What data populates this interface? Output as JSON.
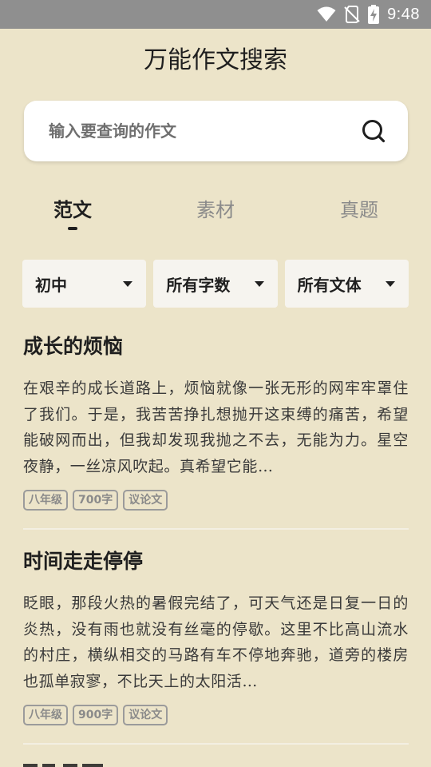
{
  "status_bar": {
    "time": "9:48",
    "icons": [
      "wifi-icon",
      "no-sim-icon",
      "battery-charging-icon"
    ]
  },
  "header": {
    "title": "万能作文搜索"
  },
  "search": {
    "placeholder": "输入要查询的作文",
    "icon": "search-icon"
  },
  "tabs": [
    {
      "label": "范文",
      "active": true
    },
    {
      "label": "素材",
      "active": false
    },
    {
      "label": "真题",
      "active": false
    }
  ],
  "filters": [
    {
      "label": "初中"
    },
    {
      "label": "所有字数"
    },
    {
      "label": "所有文体"
    }
  ],
  "essays": [
    {
      "title": "成长的烦恼",
      "excerpt": "在艰辛的成长道路上，烦恼就像一张无形的网牢牢罩住了我们。于是，我苦苦挣扎想抛开这束缚的痛苦，希望能破网而出，但我却发现我抛之不去，无能为力。星空夜静，一丝凉风吹起。真希望它能…",
      "tags": [
        "八年级",
        "700字",
        "议论文"
      ]
    },
    {
      "title": "时间走走停停",
      "excerpt": "眨眼，那段火热的暑假完结了，可天气还是日复一日的炎热，没有雨也就没有丝毫的停歇。这里不比高山流水的村庄，横纵相交的马路有车不停地奔驰，道旁的楼房也孤单寂寥，不比天上的太阳活…",
      "tags": [
        "八年级",
        "900字",
        "议论文"
      ]
    }
  ],
  "colors": {
    "background": "#ece4c9",
    "status_bar": "#8f8f8f",
    "card": "#ffffff",
    "filter_bg": "#f6f4ef",
    "tag_border": "#9b9b9b"
  }
}
